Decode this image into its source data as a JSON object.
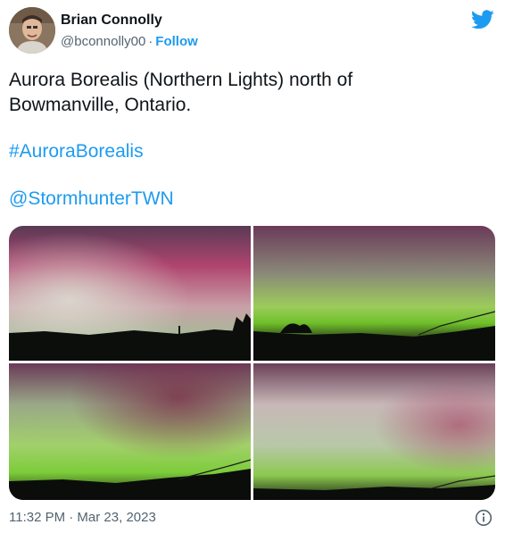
{
  "author": {
    "name": "Brian Connolly",
    "handle": "@bconnolly00",
    "separator": "·",
    "follow_label": "Follow"
  },
  "tweet": {
    "text_lines": [
      "Aurora Borealis (Northern Lights) north of",
      "Bowmanville, Ontario."
    ],
    "hashtag": "#AuroraBorealis",
    "mention": "@StormhunterTWN"
  },
  "media": {
    "photo_count": 4
  },
  "footer": {
    "timestamp": "11:32 PM · Mar 23, 2023",
    "info_icon": "info-circle-icon"
  },
  "colors": {
    "link": "#1d9bf0",
    "text": "#0f1419",
    "secondary": "#536471",
    "twitter_brand": "#1d9bf0"
  },
  "icons": [
    "twitter-bird-icon",
    "info-circle-icon"
  ]
}
